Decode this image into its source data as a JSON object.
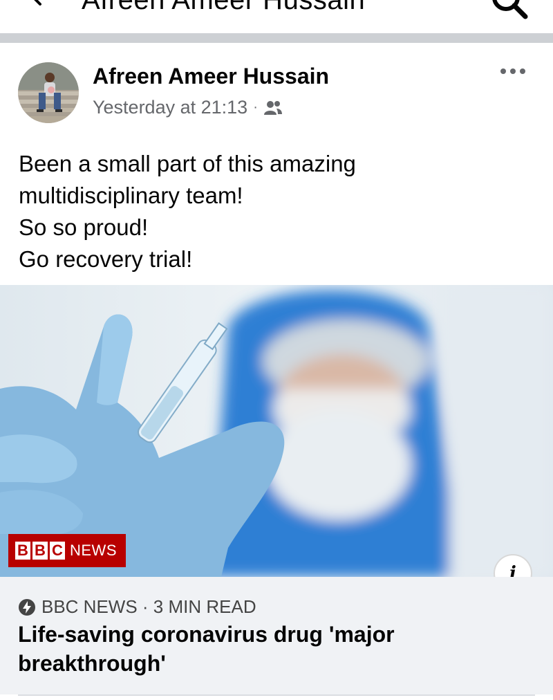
{
  "header": {
    "title": "Afreen Ameer Hussain"
  },
  "post": {
    "author": "Afreen Ameer Hussain",
    "timestamp": "Yesterday at 21:13",
    "separator": "·",
    "audience_icon": "friends-icon",
    "more_icon": "more-options-icon",
    "text_lines": [
      "Been a small part of this amazing",
      "multidisciplinary team!",
      "So so proud!",
      "Go recovery trial!"
    ]
  },
  "link": {
    "logo_letters": [
      "B",
      "B",
      "C"
    ],
    "logo_word": "NEWS",
    "info_label": "i",
    "source": "BBC NEWS · 3 MIN READ",
    "headline": "Life-saving coronavirus drug 'major breakthrough'"
  },
  "colors": {
    "brand_red": "#b80000",
    "secondary_text": "#65676b",
    "caption_bg": "#f0f2f5"
  }
}
